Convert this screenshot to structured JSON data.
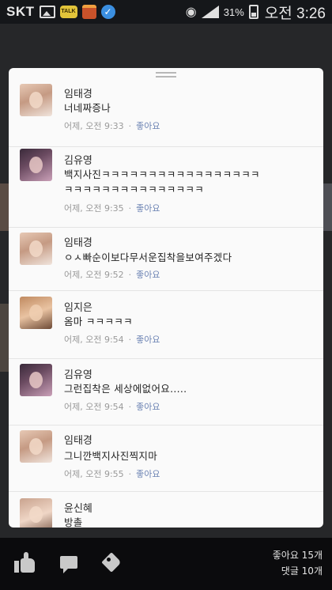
{
  "status_bar": {
    "carrier": "SKT",
    "battery_percent": "31%",
    "time": "오전 3:26",
    "icons": [
      "gallery-icon",
      "talk-icon",
      "book-icon",
      "check-icon",
      "wifi-icon",
      "signal-icon",
      "battery-icon"
    ],
    "talk_icon_text": "TALK"
  },
  "comments": [
    {
      "name": "임태경",
      "text": "너네짜증나",
      "date": "어제, 오전 9:33",
      "dot": "·",
      "like": "좋아요",
      "avatar": "av-a"
    },
    {
      "name": "김유영",
      "text": "백지사진ㅋㅋㅋㅋㅋㅋㅋㅋㅋㅋㅋㅋㅋㅋㅋㅋㅋ\nㅋㅋㅋㅋㅋㅋㅋㅋㅋㅋㅋㅋㅋㅋㅋ",
      "date": "어제, 오전 9:35",
      "dot": "·",
      "like": "좋아요",
      "avatar": "av-b"
    },
    {
      "name": "임태경",
      "text": "ㅇㅅ빠순이보다무서운집착을보여주겠다",
      "date": "어제, 오전 9:52",
      "dot": "·",
      "like": "좋아요",
      "avatar": "av-a"
    },
    {
      "name": "임지은",
      "text": "옴마 ㅋㅋㅋㅋㅋ",
      "date": "어제, 오전 9:54",
      "dot": "·",
      "like": "좋아요",
      "avatar": "av-c"
    },
    {
      "name": "김유영",
      "text": "그런집착은 세상에없어요.....",
      "date": "어제, 오전 9:54",
      "dot": "·",
      "like": "좋아요",
      "avatar": "av-b"
    },
    {
      "name": "임태경",
      "text": "그니깐백지사진찍지마",
      "date": "어제, 오전 9:55",
      "dot": "·",
      "like": "좋아요",
      "avatar": "av-a"
    },
    {
      "name": "윤신혜",
      "text": "방촐",
      "date": "",
      "dot": "",
      "like": "",
      "avatar": "av-d"
    }
  ],
  "footer": {
    "like_count": "좋아요 15개",
    "comment_count": "댓글 10개"
  }
}
